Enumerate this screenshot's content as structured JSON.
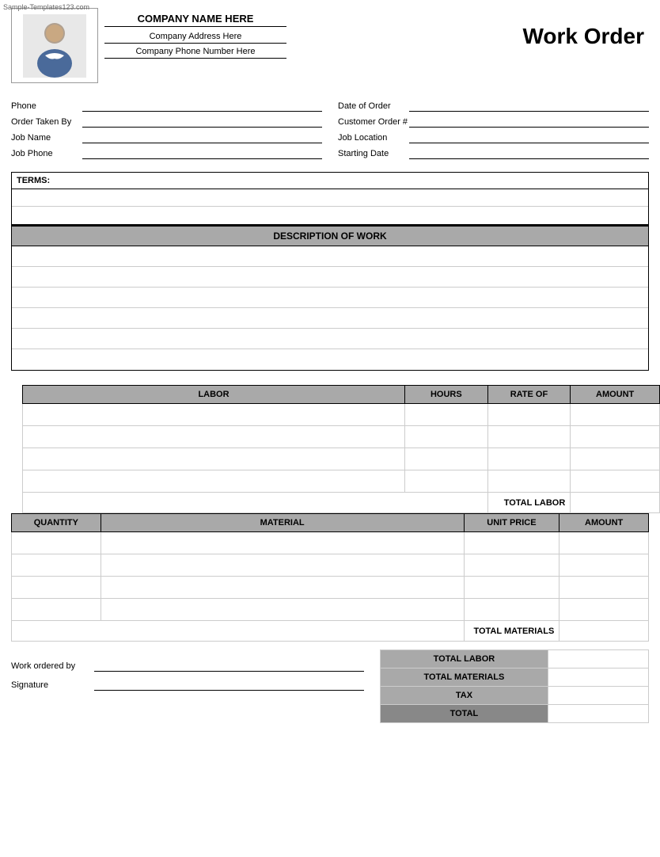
{
  "watermark": "Sample-Templates123.com",
  "header": {
    "company_name": "COMPANY NAME HERE",
    "company_address": "Company Address Here",
    "company_phone": "Company Phone Number Here",
    "title": "Work Order"
  },
  "form": {
    "left": [
      {
        "label": "Phone",
        "value": ""
      },
      {
        "label": "Order Taken By",
        "value": ""
      },
      {
        "label": "Job Name",
        "value": ""
      },
      {
        "label": "Job Phone",
        "value": ""
      }
    ],
    "right": [
      {
        "label": "Date of Order",
        "value": ""
      },
      {
        "label": "Customer Order #",
        "value": ""
      },
      {
        "label": "Job Location",
        "value": ""
      },
      {
        "label": "Starting Date",
        "value": ""
      }
    ]
  },
  "terms": {
    "label": "TERMS:",
    "rows": 3
  },
  "description": {
    "header": "DESCRIPTION OF WORK",
    "rows": 6
  },
  "labor": {
    "columns": [
      "LABOR",
      "HOURS",
      "RATE OF",
      "AMOUNT"
    ],
    "rows": 4,
    "total_label": "TOTAL LABOR"
  },
  "materials": {
    "columns": [
      "QUANTITY",
      "MATERIAL",
      "UNIT PRICE",
      "AMOUNT"
    ],
    "rows": 4,
    "total_label": "TOTAL MATERIALS"
  },
  "signature": {
    "work_ordered_by_label": "Work ordered by",
    "signature_label": "Signature"
  },
  "totals": [
    {
      "label": "TOTAL LABOR",
      "value": ""
    },
    {
      "label": "TOTAL MATERIALS",
      "value": ""
    },
    {
      "label": "TAX",
      "value": ""
    },
    {
      "label": "TOTAL",
      "value": ""
    }
  ]
}
